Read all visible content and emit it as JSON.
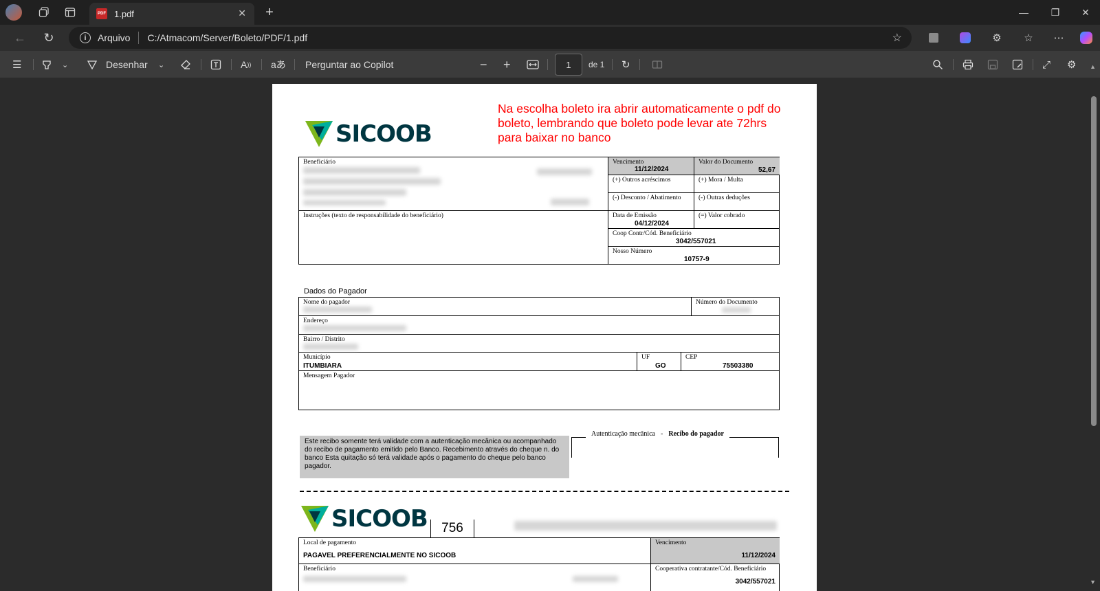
{
  "browser": {
    "tab_title": "1.pdf",
    "tab_badge": "PDF",
    "address_prefix": "Arquivo",
    "address_url": "C:/Atmacom/Server/Boleto/PDF/1.pdf"
  },
  "pdf_toolbar": {
    "draw_label": "Desenhar",
    "copilot_label": "Perguntar ao Copilot",
    "page_current": "1",
    "page_total_label": "de 1"
  },
  "document": {
    "annotation": "Na escolha boleto ira abrir automaticamente o pdf do boleto, lembrando que boleto pode levar ate 72hrs para baixar no banco",
    "bank_name": "SICOOB",
    "bank_code": "756",
    "header": {
      "beneficiario_label": "Beneficiário",
      "instrucoes_label": "Instruções (texto de responsabilidade do beneficiário)",
      "vencimento_label": "Vencimento",
      "vencimento_value": "11/12/2024",
      "valor_doc_label": "Valor do Documento",
      "valor_doc_value": "52,67",
      "outros_acrescimos_label": "(+) Outros acréscimos",
      "mora_multa_label": "(+) Mora / Multa",
      "desconto_label": "(-) Desconto / Abatimento",
      "outras_deducoes_label": "(-) Outras deduções",
      "data_emissao_label": "Data de Emissão",
      "data_emissao_value": "04/12/2024",
      "valor_cobrado_label": "(=) Valor cobrado",
      "coop_label": "Coop Contr/Cód. Beneficiário",
      "coop_value": "3042/557021",
      "nosso_numero_label": "Nosso Número",
      "nosso_numero_value": "10757-9"
    },
    "pagador": {
      "section_title": "Dados do Pagador",
      "nome_label": "Nome do pagador",
      "numero_doc_label": "Número do Documento",
      "endereco_label": "Endereço",
      "bairro_label": "Bairro / Distrito",
      "municipio_label": "Município",
      "municipio_value": "ITUMBIARA",
      "uf_label": "UF",
      "uf_value": "GO",
      "cep_label": "CEP",
      "cep_value": "75503380",
      "mensagem_label": "Mensagem Pagador"
    },
    "receipt_text": "Este recibo somente terá validade com  a autenticação mecânica ou acompanhado do recibo de pagamento emitido pelo Banco. Recebimento através do cheque n.                              do banco Esta quitação só terá validade após o pagamento do cheque pelo banco pagador.",
    "autenticacao_label": "Autenticação mecânica",
    "autenticacao_sep": "-",
    "recibo_pagador_label": "Recibo do pagador",
    "ficha": {
      "local_pagamento_label": "Local de pagamento",
      "local_pagamento_value": "PAGAVEL PREFERENCIALMENTE NO SICOOB",
      "vencimento_label": "Vencimento",
      "vencimento_value": "11/12/2024",
      "beneficiario_label": "Beneficiário",
      "coop_label": "Cooperativa contratante/Cód. Beneficiário",
      "coop_value": "3042/557021"
    }
  },
  "colors": {
    "annotation": "#ff0000",
    "sicoob_teal": "#003641",
    "sicoob_green": "#7db61c",
    "sicoob_cyan": "#00ae9d",
    "shade": "#c8c8c8"
  }
}
